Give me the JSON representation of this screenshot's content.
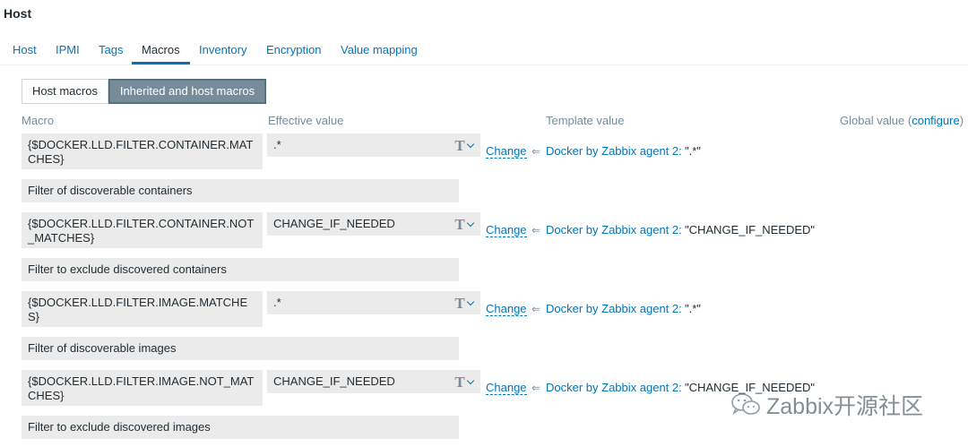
{
  "page": {
    "title": "Host"
  },
  "tabs": [
    {
      "label": "Host"
    },
    {
      "label": "IPMI"
    },
    {
      "label": "Tags"
    },
    {
      "label": "Macros",
      "active": true
    },
    {
      "label": "Inventory"
    },
    {
      "label": "Encryption"
    },
    {
      "label": "Value mapping"
    }
  ],
  "segment": {
    "host_macros": "Host macros",
    "inherited": "Inherited and host macros",
    "selected": "Inherited and host macros"
  },
  "columns": {
    "macro": "Macro",
    "effective": "Effective value",
    "template": "Template value",
    "global": "Global value (",
    "global_link": "configure",
    "global_close": ")"
  },
  "rows": [
    {
      "macro": "{$DOCKER.LLD.FILTER.CONTAINER.MAT CHES}",
      "value": ".*",
      "type_icon": "T",
      "change": "Change",
      "arrow": "⇐",
      "template": "Docker by Zabbix agent 2:",
      "template_value": "\".*\"",
      "description": "Filter of discoverable containers"
    },
    {
      "macro": "{$DOCKER.LLD.FILTER.CONTAINER.NOT _MATCHES}",
      "value": "CHANGE_IF_NEEDED",
      "type_icon": "T",
      "change": "Change",
      "arrow": "⇐",
      "template": "Docker by Zabbix agent 2:",
      "template_value": "\"CHANGE_IF_NEEDED\"",
      "description": "Filter to exclude discovered containers"
    },
    {
      "macro": "{$DOCKER.LLD.FILTER.IMAGE.MATCHE S}",
      "value": ".*",
      "type_icon": "T",
      "change": "Change",
      "arrow": "⇐",
      "template": "Docker by Zabbix agent 2:",
      "template_value": "\".*\"",
      "description": "Filter of discoverable images"
    },
    {
      "macro": "{$DOCKER.LLD.FILTER.IMAGE.NOT_MAT CHES}",
      "value": "CHANGE_IF_NEEDED",
      "type_icon": "T",
      "change": "Change",
      "arrow": "⇐",
      "template": "Docker by Zabbix agent 2:",
      "template_value": "\"CHANGE_IF_NEEDED\"",
      "description": "Filter to exclude discovered images"
    }
  ],
  "watermark": {
    "text": "Zabbix开源社区",
    "icon": "wechat-icon"
  },
  "colors": {
    "link": "#0275b8",
    "muted": "#768d99",
    "field_bg": "#ebebeb",
    "active_btn": "#768d99"
  }
}
